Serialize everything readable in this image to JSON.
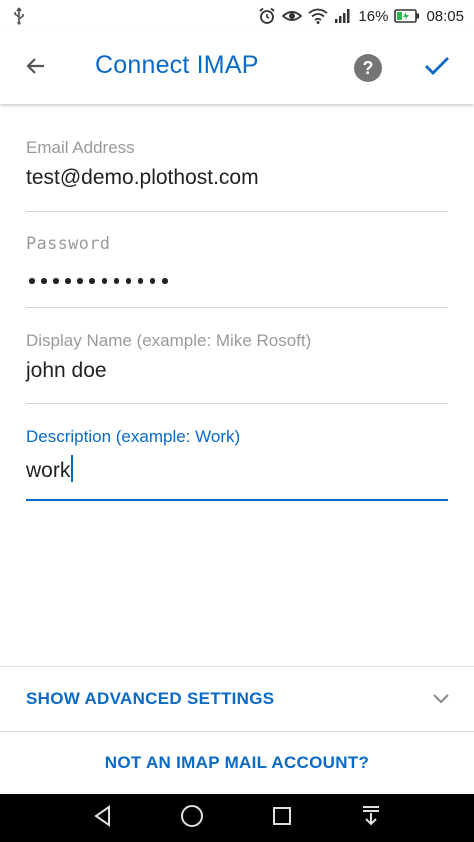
{
  "status_bar": {
    "battery_percent": "16%",
    "time": "08:05",
    "icons": [
      "usb-icon",
      "alarm-icon",
      "eye-icon",
      "wifi-icon",
      "signal-icon",
      "battery-charging-icon"
    ]
  },
  "app_bar": {
    "title": "Connect IMAP",
    "icons": [
      "back-arrow-icon",
      "help-icon",
      "checkmark-icon"
    ],
    "help_glyph": "?"
  },
  "form": {
    "email": {
      "label": "Email Address",
      "value": "test@demo.plothost.com"
    },
    "password": {
      "label": "Password",
      "masked_length": 12
    },
    "display_name": {
      "label": "Display Name (example: Mike Rosoft)",
      "value": "john doe"
    },
    "description": {
      "label": "Description (example: Work)",
      "value": "work"
    }
  },
  "advanced": {
    "label": "SHOW ADVANCED SETTINGS",
    "icon": "chevron-down-icon"
  },
  "not_imap": {
    "label": "NOT AN IMAP MAIL ACCOUNT?"
  },
  "nav_bar": {
    "icons": [
      "nav-back-icon",
      "nav-home-icon",
      "nav-recents-icon",
      "nav-notifications-icon"
    ]
  },
  "colors": {
    "accent": "#0a6ac6",
    "label_gray": "#9a9a9a",
    "help_gray": "#757575"
  }
}
